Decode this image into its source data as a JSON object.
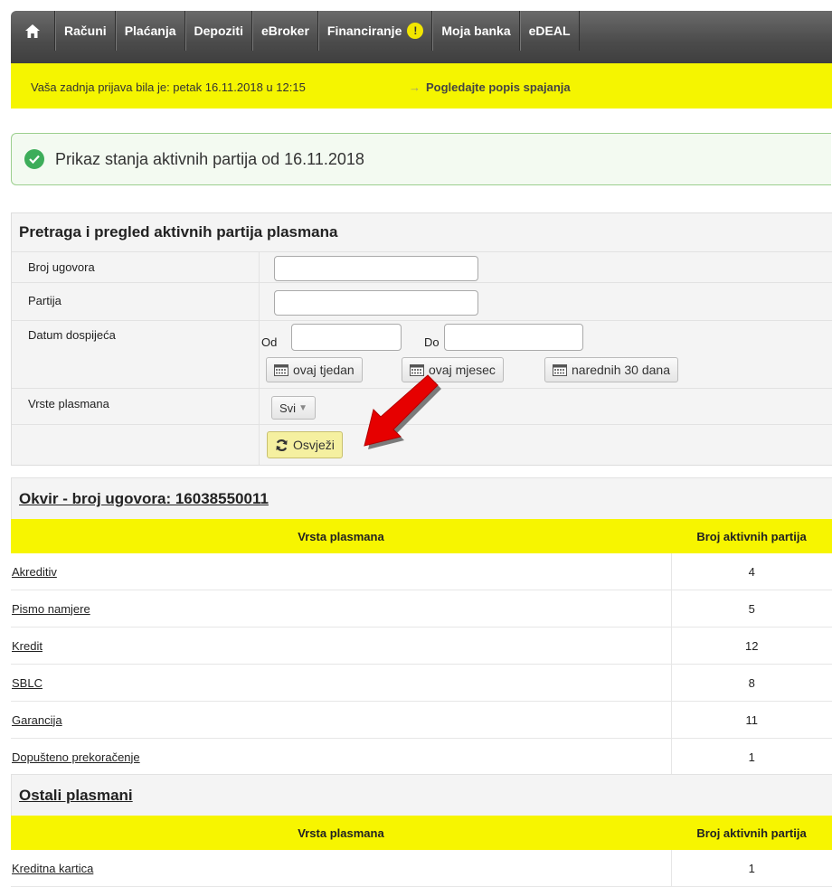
{
  "nav": {
    "items": [
      "Računi",
      "Plaćanja",
      "Depoziti",
      "eBroker",
      "Financiranje",
      "Moja banka",
      "eDEAL"
    ],
    "badge": "!"
  },
  "infobar": {
    "last_login": "Vaša zadnja prijava bila je: petak 16.11.2018 u 12:15",
    "link": "Pogledajte popis spajanja"
  },
  "status": {
    "text": "Prikaz stanja aktivnih partija od 16.11.2018"
  },
  "search": {
    "title": "Pretraga i pregled aktivnih partija plasmana",
    "label_contract": "Broj ugovora",
    "label_account": "Partija",
    "label_due": "Datum dospijeća",
    "from": "Od",
    "to": "Do",
    "btn_week": "ovaj tjedan",
    "btn_month": "ovaj mjesec",
    "btn_30": "narednih 30 dana",
    "label_types": "Vrste plasmana",
    "types_value": "Svi",
    "refresh": "Osvježi"
  },
  "frame": {
    "title": "Okvir - broj ugovora: 16038550011",
    "col_type": "Vrsta plasmana",
    "col_count": "Broj aktivnih partija",
    "rows": [
      {
        "name": "Akreditiv",
        "count": "4"
      },
      {
        "name": "Pismo namjere",
        "count": "5"
      },
      {
        "name": "Kredit",
        "count": "12"
      },
      {
        "name": "SBLC",
        "count": "8"
      },
      {
        "name": "Garancija",
        "count": "11"
      },
      {
        "name": "Dopušteno prekoračenje",
        "count": "1"
      }
    ]
  },
  "other": {
    "title": "Ostali plasmani",
    "col_type": "Vrsta plasmana",
    "col_count": "Broj aktivnih partija",
    "rows": [
      {
        "name": "Kreditna kartica",
        "count": "1"
      }
    ]
  }
}
